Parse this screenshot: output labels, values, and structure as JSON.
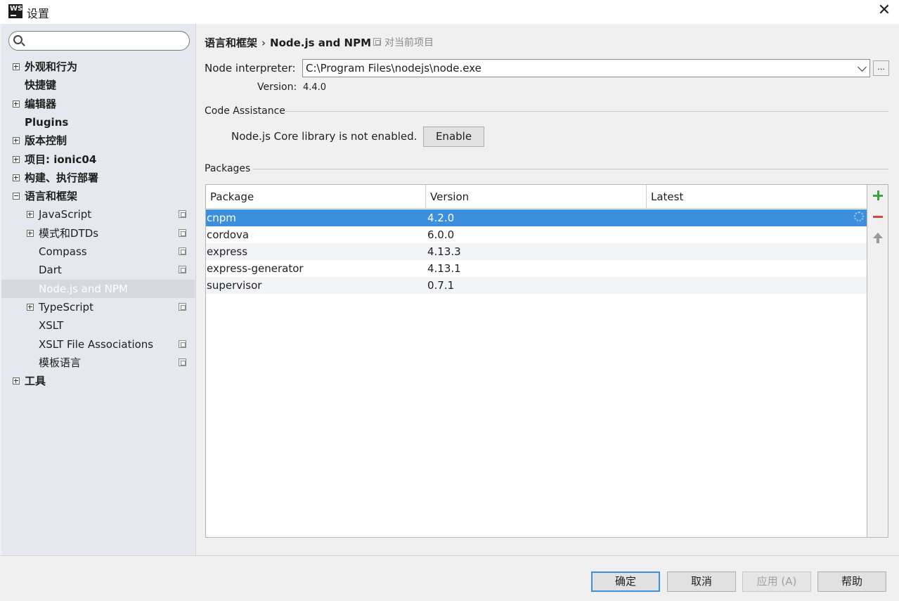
{
  "window": {
    "title": "设置",
    "logo_text": "WS"
  },
  "search": {
    "placeholder": ""
  },
  "sidebar": {
    "items": [
      {
        "label": "外观和行为",
        "bold": true,
        "expander": "plus",
        "proj": false
      },
      {
        "label": "快捷键",
        "bold": true,
        "expander": "",
        "proj": false
      },
      {
        "label": "编辑器",
        "bold": true,
        "expander": "plus",
        "proj": false
      },
      {
        "label": "Plugins",
        "bold": true,
        "expander": "",
        "proj": false
      },
      {
        "label": "版本控制",
        "bold": true,
        "expander": "plus",
        "proj": false
      },
      {
        "label": "项目: ionic04",
        "bold": true,
        "expander": "plus",
        "proj": false
      },
      {
        "label": "构建、执行部署",
        "bold": true,
        "expander": "plus",
        "proj": false
      },
      {
        "label": "语言和框架",
        "bold": true,
        "expander": "minus",
        "proj": false
      },
      {
        "label": "JavaScript",
        "bold": false,
        "expander": "plus",
        "proj": true
      },
      {
        "label": "模式和DTDs",
        "bold": false,
        "expander": "plus",
        "proj": true
      },
      {
        "label": "Compass",
        "bold": false,
        "expander": "",
        "proj": true
      },
      {
        "label": "Dart",
        "bold": false,
        "expander": "",
        "proj": true
      },
      {
        "label": "Node.js and NPM",
        "bold": false,
        "expander": "",
        "proj": false,
        "selected": true
      },
      {
        "label": "TypeScript",
        "bold": false,
        "expander": "plus",
        "proj": true
      },
      {
        "label": "XSLT",
        "bold": false,
        "expander": "",
        "proj": false
      },
      {
        "label": "XSLT File Associations",
        "bold": false,
        "expander": "",
        "proj": true
      },
      {
        "label": "模板语言",
        "bold": false,
        "expander": "",
        "proj": true
      },
      {
        "label": "工具",
        "bold": true,
        "expander": "plus",
        "proj": false
      }
    ]
  },
  "breadcrumb": {
    "parent": "语言和框架",
    "separator": "›",
    "current": "Node.js and NPM",
    "scope": "对当前项目"
  },
  "interpreter": {
    "label": "Node interpreter:",
    "value": "C:\\Program Files\\nodejs\\node.exe",
    "browse": "...",
    "version_label": "Version:",
    "version": "4.4.0"
  },
  "code_assistance": {
    "title": "Code Assistance",
    "message": "Node.js Core library is not enabled.",
    "enable": "Enable"
  },
  "packages": {
    "title": "Packages",
    "headers": [
      "Package",
      "Version",
      "Latest"
    ],
    "rows": [
      {
        "package": "cnpm",
        "version": "4.2.0",
        "latest": ""
      },
      {
        "package": "cordova",
        "version": "6.0.0",
        "latest": ""
      },
      {
        "package": "express",
        "version": "4.13.3",
        "latest": ""
      },
      {
        "package": "express-generator",
        "version": "4.13.1",
        "latest": ""
      },
      {
        "package": "supervisor",
        "version": "0.7.1",
        "latest": ""
      }
    ],
    "selected_row": 0
  },
  "buttons": {
    "ok": "确定",
    "cancel": "取消",
    "apply": "应用 (A)",
    "help": "帮助"
  },
  "colors": {
    "selection": "#3c8fdc",
    "add": "#3ea53e",
    "remove": "#d9463a"
  }
}
